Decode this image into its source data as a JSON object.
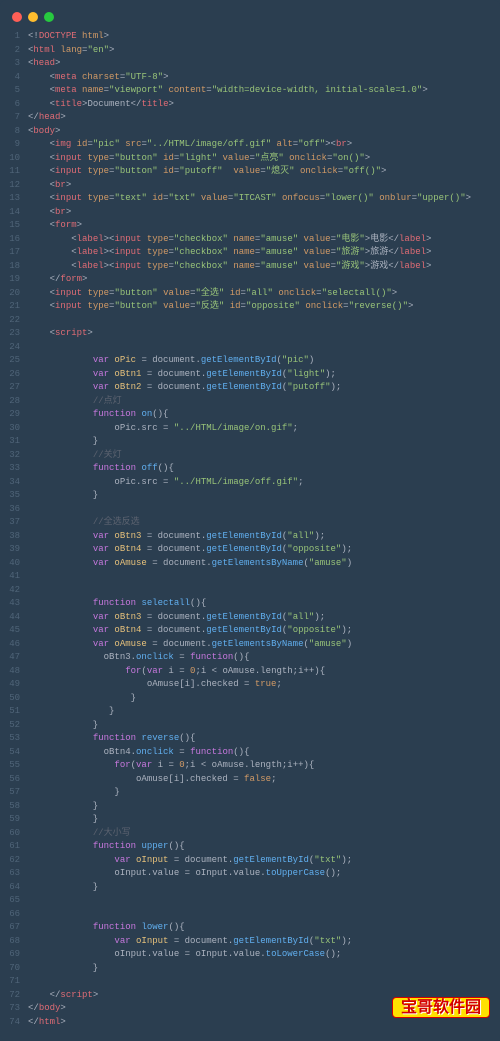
{
  "window": {
    "traffic_lights": [
      "close",
      "minimize",
      "zoom"
    ]
  },
  "watermark": "宝哥软件园",
  "code_lines": [
    {
      "n": 1,
      "html": "<span class='punc'>&lt;!</span><span class='tag'>DOCTYPE</span> <span class='attr'>html</span><span class='punc'>&gt;</span>"
    },
    {
      "n": 2,
      "html": "<span class='punc'>&lt;</span><span class='tag'>html</span> <span class='attr'>lang</span><span class='punc'>=</span><span class='str'>\"en\"</span><span class='punc'>&gt;</span>"
    },
    {
      "n": 3,
      "html": "<span class='punc'>&lt;</span><span class='tag'>head</span><span class='punc'>&gt;</span>"
    },
    {
      "n": 4,
      "html": "    <span class='punc'>&lt;</span><span class='tag'>meta</span> <span class='attr'>charset</span><span class='punc'>=</span><span class='str'>\"UTF-8\"</span><span class='punc'>&gt;</span>"
    },
    {
      "n": 5,
      "html": "    <span class='punc'>&lt;</span><span class='tag'>meta</span> <span class='attr'>name</span><span class='punc'>=</span><span class='str'>\"viewport\"</span> <span class='attr'>content</span><span class='punc'>=</span><span class='str'>\"width=device-width, initial-scale=1.0\"</span><span class='punc'>&gt;</span>"
    },
    {
      "n": 6,
      "html": "    <span class='punc'>&lt;</span><span class='tag'>title</span><span class='punc'>&gt;</span>Document<span class='punc'>&lt;/</span><span class='tag'>title</span><span class='punc'>&gt;</span>"
    },
    {
      "n": 7,
      "html": "<span class='punc'>&lt;/</span><span class='tag'>head</span><span class='punc'>&gt;</span>"
    },
    {
      "n": 8,
      "html": "<span class='punc'>&lt;</span><span class='tag'>body</span><span class='punc'>&gt;</span>"
    },
    {
      "n": 9,
      "html": "    <span class='punc'>&lt;</span><span class='tag'>img</span> <span class='attr'>id</span><span class='punc'>=</span><span class='str'>\"pic\"</span> <span class='attr'>src</span><span class='punc'>=</span><span class='str'>\"../HTML/image/off.gif\"</span> <span class='attr'>alt</span><span class='punc'>=</span><span class='str'>\"off\"</span><span class='punc'>&gt;&lt;</span><span class='tag'>br</span><span class='punc'>&gt;</span>"
    },
    {
      "n": 10,
      "html": "    <span class='punc'>&lt;</span><span class='tag'>input</span> <span class='attr'>type</span><span class='punc'>=</span><span class='str'>\"button\"</span> <span class='attr'>id</span><span class='punc'>=</span><span class='str'>\"light\"</span> <span class='attr'>value</span><span class='punc'>=</span><span class='str'>\"点亮\"</span> <span class='attr'>onclick</span><span class='punc'>=</span><span class='str'>\"on()\"</span><span class='punc'>&gt;</span>"
    },
    {
      "n": 11,
      "html": "    <span class='punc'>&lt;</span><span class='tag'>input</span> <span class='attr'>type</span><span class='punc'>=</span><span class='str'>\"button\"</span> <span class='attr'>id</span><span class='punc'>=</span><span class='str'>\"putoff\"</span>  <span class='attr'>value</span><span class='punc'>=</span><span class='str'>\"熄灭\"</span> <span class='attr'>onclick</span><span class='punc'>=</span><span class='str'>\"off()\"</span><span class='punc'>&gt;</span>"
    },
    {
      "n": 12,
      "html": "    <span class='punc'>&lt;</span><span class='tag'>br</span><span class='punc'>&gt;</span>"
    },
    {
      "n": 13,
      "html": "    <span class='punc'>&lt;</span><span class='tag'>input</span> <span class='attr'>type</span><span class='punc'>=</span><span class='str'>\"text\"</span> <span class='attr'>id</span><span class='punc'>=</span><span class='str'>\"txt\"</span> <span class='attr'>value</span><span class='punc'>=</span><span class='str'>\"ITCAST\"</span> <span class='attr'>onfocus</span><span class='punc'>=</span><span class='str'>\"lower()\"</span> <span class='attr'>onblur</span><span class='punc'>=</span><span class='str'>\"upper()\"</span><span class='punc'>&gt;</span>"
    },
    {
      "n": 14,
      "html": "    <span class='punc'>&lt;</span><span class='tag'>br</span><span class='punc'>&gt;</span>"
    },
    {
      "n": 15,
      "html": "    <span class='punc'>&lt;</span><span class='tag'>form</span><span class='punc'>&gt;</span>"
    },
    {
      "n": 16,
      "html": "        <span class='punc'>&lt;</span><span class='tag'>label</span><span class='punc'>&gt;&lt;</span><span class='tag'>input</span> <span class='attr'>type</span><span class='punc'>=</span><span class='str'>\"checkbox\"</span> <span class='attr'>name</span><span class='punc'>=</span><span class='str'>\"amuse\"</span> <span class='attr'>value</span><span class='punc'>=</span><span class='str'>\"电影\"</span><span class='punc'>&gt;</span>电影<span class='punc'>&lt;/</span><span class='tag'>label</span><span class='punc'>&gt;</span>"
    },
    {
      "n": 17,
      "html": "        <span class='punc'>&lt;</span><span class='tag'>label</span><span class='punc'>&gt;&lt;</span><span class='tag'>input</span> <span class='attr'>type</span><span class='punc'>=</span><span class='str'>\"checkbox\"</span> <span class='attr'>name</span><span class='punc'>=</span><span class='str'>\"amuse\"</span> <span class='attr'>value</span><span class='punc'>=</span><span class='str'>\"旅游\"</span><span class='punc'>&gt;</span>旅游<span class='punc'>&lt;/</span><span class='tag'>label</span><span class='punc'>&gt;</span>"
    },
    {
      "n": 18,
      "html": "        <span class='punc'>&lt;</span><span class='tag'>label</span><span class='punc'>&gt;&lt;</span><span class='tag'>input</span> <span class='attr'>type</span><span class='punc'>=</span><span class='str'>\"checkbox\"</span> <span class='attr'>name</span><span class='punc'>=</span><span class='str'>\"amuse\"</span> <span class='attr'>value</span><span class='punc'>=</span><span class='str'>\"游戏\"</span><span class='punc'>&gt;</span>游戏<span class='punc'>&lt;/</span><span class='tag'>label</span><span class='punc'>&gt;</span>"
    },
    {
      "n": 19,
      "html": "    <span class='punc'>&lt;/</span><span class='tag'>form</span><span class='punc'>&gt;</span>"
    },
    {
      "n": 20,
      "html": "    <span class='punc'>&lt;</span><span class='tag'>input</span> <span class='attr'>type</span><span class='punc'>=</span><span class='str'>\"button\"</span> <span class='attr'>value</span><span class='punc'>=</span><span class='str'>\"全选\"</span> <span class='attr'>id</span><span class='punc'>=</span><span class='str'>\"all\"</span> <span class='attr'>onclick</span><span class='punc'>=</span><span class='str'>\"selectall()\"</span><span class='punc'>&gt;</span>"
    },
    {
      "n": 21,
      "html": "    <span class='punc'>&lt;</span><span class='tag'>input</span> <span class='attr'>type</span><span class='punc'>=</span><span class='str'>\"button\"</span> <span class='attr'>value</span><span class='punc'>=</span><span class='str'>\"反选\"</span> <span class='attr'>id</span><span class='punc'>=</span><span class='str'>\"opposite\"</span> <span class='attr'>onclick</span><span class='punc'>=</span><span class='str'>\"reverse()\"</span><span class='punc'>&gt;</span>"
    },
    {
      "n": 22,
      "html": ""
    },
    {
      "n": 23,
      "html": "    <span class='punc'>&lt;</span><span class='tag'>script</span><span class='punc'>&gt;</span>"
    },
    {
      "n": 24,
      "html": ""
    },
    {
      "n": 25,
      "html": "            <span class='kw'>var</span> <span class='var'>oPic</span> <span class='punc'>=</span> document.<span class='fn'>getElementById</span>(<span class='str'>\"pic\"</span>)"
    },
    {
      "n": 26,
      "html": "            <span class='kw'>var</span> <span class='var'>oBtn1</span> <span class='punc'>=</span> document.<span class='fn'>getElementById</span>(<span class='str'>\"light\"</span>);"
    },
    {
      "n": 27,
      "html": "            <span class='kw'>var</span> <span class='var'>oBtn2</span> <span class='punc'>=</span> document.<span class='fn'>getElementById</span>(<span class='str'>\"putoff\"</span>);"
    },
    {
      "n": 28,
      "html": "            <span class='cmt'>//点灯</span>"
    },
    {
      "n": 29,
      "html": "            <span class='kw'>function</span> <span class='fn'>on</span>(){"
    },
    {
      "n": 30,
      "html": "                oPic.src <span class='punc'>=</span> <span class='str'>\"../HTML/image/on.gif\"</span>;"
    },
    {
      "n": 31,
      "html": "            }"
    },
    {
      "n": 32,
      "html": "            <span class='cmt'>//关灯</span>"
    },
    {
      "n": 33,
      "html": "            <span class='kw'>function</span> <span class='fn'>off</span>(){"
    },
    {
      "n": 34,
      "html": "                oPic.src <span class='punc'>=</span> <span class='str'>\"../HTML/image/off.gif\"</span>;"
    },
    {
      "n": 35,
      "html": "            }"
    },
    {
      "n": 36,
      "html": ""
    },
    {
      "n": 37,
      "html": "            <span class='cmt'>//全选反选</span>"
    },
    {
      "n": 38,
      "html": "            <span class='kw'>var</span> <span class='var'>oBtn3</span> <span class='punc'>=</span> document.<span class='fn'>getElementById</span>(<span class='str'>\"all\"</span>);"
    },
    {
      "n": 39,
      "html": "            <span class='kw'>var</span> <span class='var'>oBtn4</span> <span class='punc'>=</span> document.<span class='fn'>getElementById</span>(<span class='str'>\"opposite\"</span>);"
    },
    {
      "n": 40,
      "html": "            <span class='kw'>var</span> <span class='var'>oAmuse</span> <span class='punc'>=</span> document.<span class='fn'>getElementsByName</span>(<span class='str'>\"amuse\"</span>)"
    },
    {
      "n": 41,
      "html": ""
    },
    {
      "n": 42,
      "html": ""
    },
    {
      "n": 43,
      "html": "            <span class='kw'>function</span> <span class='fn'>selectall</span>(){"
    },
    {
      "n": 44,
      "html": "            <span class='kw'>var</span> <span class='var'>oBtn3</span> <span class='punc'>=</span> document.<span class='fn'>getElementById</span>(<span class='str'>\"all\"</span>);"
    },
    {
      "n": 45,
      "html": "            <span class='kw'>var</span> <span class='var'>oBtn4</span> <span class='punc'>=</span> document.<span class='fn'>getElementById</span>(<span class='str'>\"opposite\"</span>);"
    },
    {
      "n": 46,
      "html": "            <span class='kw'>var</span> <span class='var'>oAmuse</span> <span class='punc'>=</span> document.<span class='fn'>getElementsByName</span>(<span class='str'>\"amuse\"</span>)"
    },
    {
      "n": 47,
      "html": "              oBtn3.<span class='fn'>onclick</span> <span class='punc'>=</span> <span class='kw'>function</span>(){"
    },
    {
      "n": 48,
      "html": "                  <span class='kw'>for</span>(<span class='kw'>var</span> i <span class='punc'>=</span> <span class='num'>0</span>;i <span class='punc'>&lt;</span> oAmuse.length;i<span class='punc'>++</span>){"
    },
    {
      "n": 49,
      "html": "                      oAmuse[i].checked <span class='punc'>=</span> <span class='bool'>true</span>;"
    },
    {
      "n": 50,
      "html": "                   }"
    },
    {
      "n": 51,
      "html": "               }"
    },
    {
      "n": 52,
      "html": "            }"
    },
    {
      "n": 53,
      "html": "            <span class='kw'>function</span> <span class='fn'>reverse</span>(){"
    },
    {
      "n": 54,
      "html": "              oBtn4.<span class='fn'>onclick</span> <span class='punc'>=</span> <span class='kw'>function</span>(){"
    },
    {
      "n": 55,
      "html": "                <span class='kw'>for</span>(<span class='kw'>var</span> i <span class='punc'>=</span> <span class='num'>0</span>;i <span class='punc'>&lt;</span> oAmuse.length;i<span class='punc'>++</span>){"
    },
    {
      "n": 56,
      "html": "                    oAmuse[i].checked <span class='punc'>=</span> <span class='bool'>false</span>;"
    },
    {
      "n": 57,
      "html": "                }"
    },
    {
      "n": 58,
      "html": "            }"
    },
    {
      "n": 59,
      "html": "            }"
    },
    {
      "n": 60,
      "html": "            <span class='cmt'>//大小写</span>"
    },
    {
      "n": 61,
      "html": "            <span class='kw'>function</span> <span class='fn'>upper</span>(){"
    },
    {
      "n": 62,
      "html": "                <span class='kw'>var</span> <span class='var'>oInput</span> <span class='punc'>=</span> document.<span class='fn'>getElementById</span>(<span class='str'>\"txt\"</span>);"
    },
    {
      "n": 63,
      "html": "                oInput.value <span class='punc'>=</span> oInput.value.<span class='fn'>toUpperCase</span>();"
    },
    {
      "n": 64,
      "html": "            }"
    },
    {
      "n": 65,
      "html": ""
    },
    {
      "n": 66,
      "html": ""
    },
    {
      "n": 67,
      "html": "            <span class='kw'>function</span> <span class='fn'>lower</span>(){"
    },
    {
      "n": 68,
      "html": "                <span class='kw'>var</span> <span class='var'>oInput</span> <span class='punc'>=</span> document.<span class='fn'>getElementById</span>(<span class='str'>\"txt\"</span>);"
    },
    {
      "n": 69,
      "html": "                oInput.value <span class='punc'>=</span> oInput.value.<span class='fn'>toLowerCase</span>();"
    },
    {
      "n": 70,
      "html": "            }"
    },
    {
      "n": 71,
      "html": ""
    },
    {
      "n": 72,
      "html": "    <span class='punc'>&lt;/</span><span class='tag'>script</span><span class='punc'>&gt;</span>"
    },
    {
      "n": 73,
      "html": "<span class='punc'>&lt;/</span><span class='tag'>body</span><span class='punc'>&gt;</span>"
    },
    {
      "n": 74,
      "html": "<span class='punc'>&lt;/</span><span class='tag'>html</span><span class='punc'>&gt;</span>"
    }
  ]
}
